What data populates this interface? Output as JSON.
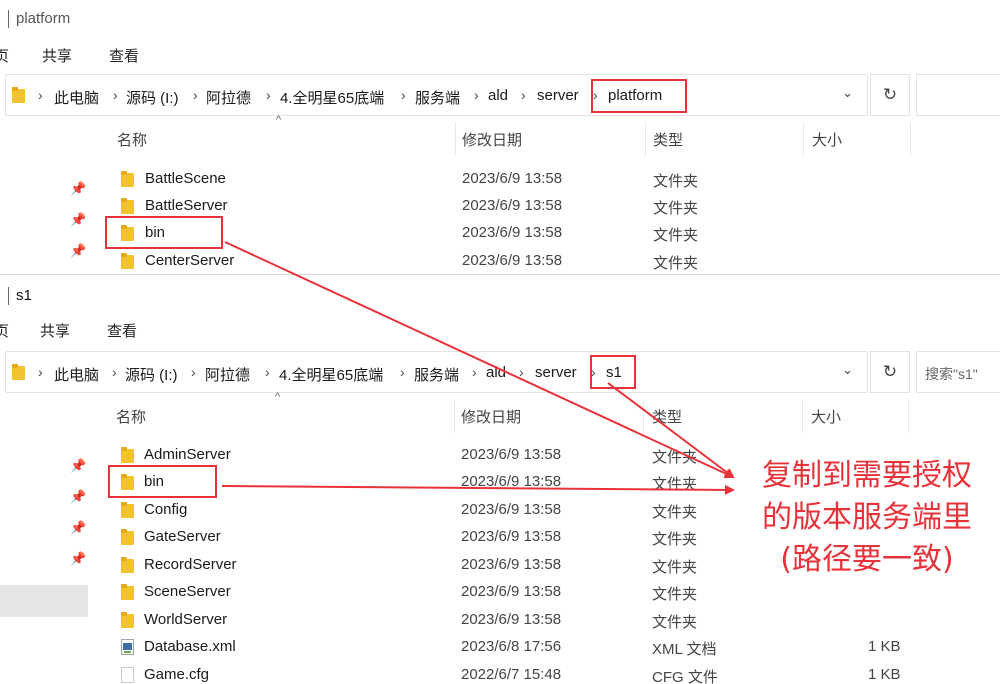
{
  "top_window": {
    "title": "platform",
    "ribbon": [
      "页",
      "共享",
      "查看"
    ],
    "breadcrumbs": [
      "此电脑",
      "源码 (I:)",
      "阿拉德",
      "4.全明星65底端",
      "服务端",
      "ald",
      "server",
      "platform"
    ],
    "columns": [
      "名称",
      "修改日期",
      "类型",
      "大小"
    ],
    "files": [
      {
        "name": "BattleScene",
        "date": "2023/6/9 13:58",
        "type": "文件夹",
        "size": ""
      },
      {
        "name": "BattleServer",
        "date": "2023/6/9 13:58",
        "type": "文件夹",
        "size": ""
      },
      {
        "name": "bin",
        "date": "2023/6/9 13:58",
        "type": "文件夹",
        "size": ""
      },
      {
        "name": "CenterServer",
        "date": "2023/6/9 13:58",
        "type": "文件夹",
        "size": ""
      }
    ]
  },
  "bottom_window": {
    "title": "s1",
    "ribbon": [
      "页",
      "共享",
      "查看"
    ],
    "breadcrumbs": [
      "此电脑",
      "源码 (I:)",
      "阿拉德",
      "4.全明星65底端",
      "服务端",
      "ald",
      "server",
      "s1"
    ],
    "search_placeholder": "搜索\"s1\"",
    "columns": [
      "名称",
      "修改日期",
      "类型",
      "大小"
    ],
    "files": [
      {
        "name": "AdminServer",
        "date": "2023/6/9 13:58",
        "type": "文件夹",
        "size": "",
        "icon": "folder-icon"
      },
      {
        "name": "bin",
        "date": "2023/6/9 13:58",
        "type": "文件夹",
        "size": "",
        "icon": "folder-icon"
      },
      {
        "name": "Config",
        "date": "2023/6/9 13:58",
        "type": "文件夹",
        "size": "",
        "icon": "folder-icon"
      },
      {
        "name": "GateServer",
        "date": "2023/6/9 13:58",
        "type": "文件夹",
        "size": "",
        "icon": "folder-icon"
      },
      {
        "name": "RecordServer",
        "date": "2023/6/9 13:58",
        "type": "文件夹",
        "size": "",
        "icon": "folder-icon"
      },
      {
        "name": "SceneServer",
        "date": "2023/6/9 13:58",
        "type": "文件夹",
        "size": "",
        "icon": "folder-icon"
      },
      {
        "name": "WorldServer",
        "date": "2023/6/9 13:58",
        "type": "文件夹",
        "size": "",
        "icon": "folder-icon"
      },
      {
        "name": "Database.xml",
        "date": "2023/6/8 17:56",
        "type": "XML 文档",
        "size": "1 KB",
        "icon": "xml-file-icon"
      },
      {
        "name": "Game.cfg",
        "date": "2022/6/7 15:48",
        "type": "CFG 文件",
        "size": "1 KB",
        "icon": "cfg-file-icon"
      }
    ]
  },
  "annotation": {
    "lines": [
      "复制到需要授权",
      "的版本服务端里",
      "(路径要一致)"
    ],
    "color": "#e8323a"
  },
  "icons": {
    "pin": "pin-icon",
    "refresh": "↻",
    "dropdown": "⌄",
    "separator": "›",
    "sort_caret": "^"
  }
}
